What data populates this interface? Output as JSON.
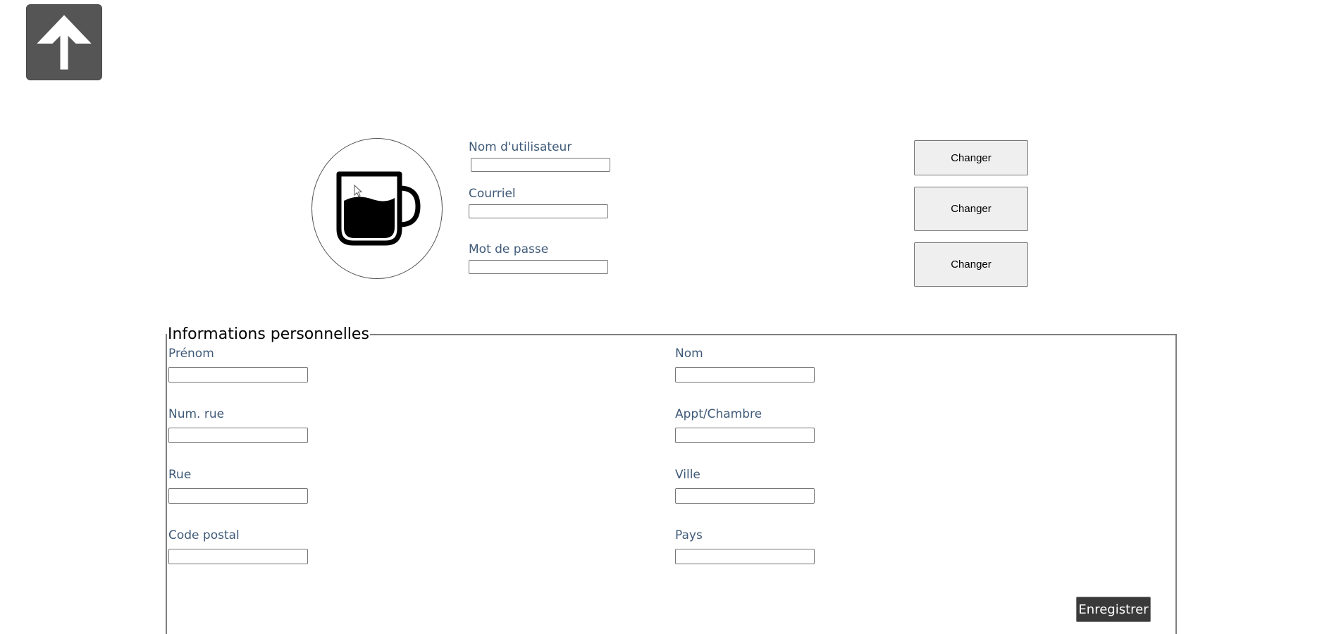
{
  "account": {
    "username_label": "Nom d'utilisateur",
    "email_label": "Courriel",
    "password_label": "Mot de passe",
    "change_username_label": "Changer",
    "change_email_label": "Changer",
    "change_password_label": "Changer"
  },
  "personal": {
    "legend": "Informations personnelles",
    "first_name_label": "Prénom",
    "last_name_label": "Nom",
    "street_number_label": "Num. rue",
    "apartment_label": "Appt/Chambre",
    "street_label": "Rue",
    "city_label": "Ville",
    "postal_code_label": "Code postal",
    "country_label": "Pays",
    "save_label": "Enregistrer"
  },
  "icons": {
    "up": "arrow-up-icon",
    "avatar": "coffee-cup-icon"
  },
  "colors": {
    "label": "#3f5a78",
    "up_button_bg": "#555555",
    "save_button_bg": "#3a3a3a",
    "change_button_bg": "#efefef"
  }
}
